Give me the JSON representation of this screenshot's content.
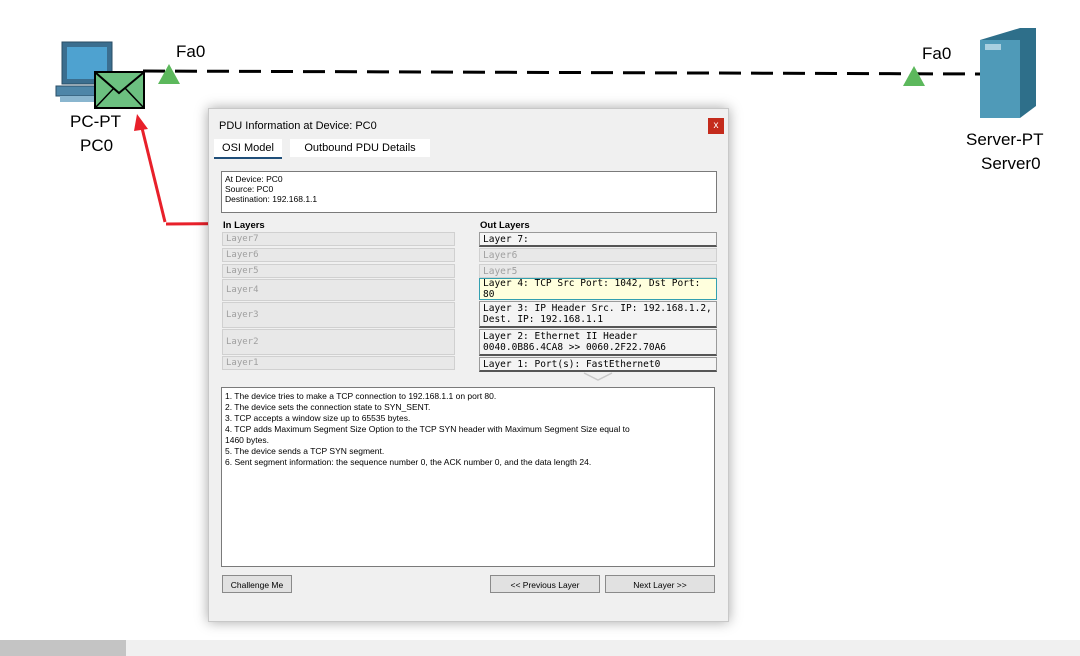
{
  "topology": {
    "pc": {
      "type_label": "PC-PT",
      "name_label": "PC0",
      "port_label": "Fa0"
    },
    "server": {
      "type_label": "Server-PT",
      "name_label": "Server0",
      "port_label": "Fa0"
    }
  },
  "dialog": {
    "title": "PDU Information at Device: PC0",
    "close_label": "x",
    "tabs": [
      "OSI Model",
      "Outbound PDU Details"
    ],
    "info": [
      "At Device: PC0",
      "Source: PC0",
      "Destination: 192.168.1.1"
    ],
    "in_layers_header": "In Layers",
    "out_layers_header": "Out Layers",
    "in_layers": [
      "Layer7",
      "Layer6",
      "Layer5",
      "Layer4",
      "Layer3",
      "Layer2",
      "Layer1"
    ],
    "out_layers": [
      "Layer 7:",
      "Layer6",
      "Layer5",
      "Layer 4: TCP Src Port: 1042, Dst Port: 80",
      [
        "Layer 3: IP Header Src. IP: 192.168.1.2,",
        "Dest. IP: 192.168.1.1"
      ],
      [
        "Layer 2: Ethernet II Header",
        "0040.0B86.4CA8 >> 0060.2F22.70A6"
      ],
      "Layer 1: Port(s): FastEthernet0"
    ],
    "description": [
      "1. The device tries to make a TCP connection to 192.168.1.1 on port 80.",
      "2. The device sets the connection state to SYN_SENT.",
      "3. TCP accepts a window size up to 65535 bytes.",
      "4. TCP adds Maximum Segment Size Option to the TCP SYN header with Maximum Segment Size equal to",
      "1460 bytes.",
      "5. The device sends a TCP SYN segment.",
      "6. Sent segment information: the sequence number 0, the ACK number 0, and the data length 24."
    ],
    "buttons": {
      "challenge": "Challenge Me",
      "previous": "<< Previous Layer",
      "next": "Next Layer >>"
    }
  },
  "colors": {
    "link_triangle": "#5cb85c",
    "annotation_arrow": "#e8202a",
    "selected_layer_bg": "#ffffdd",
    "close_button": "#c42b1c"
  }
}
